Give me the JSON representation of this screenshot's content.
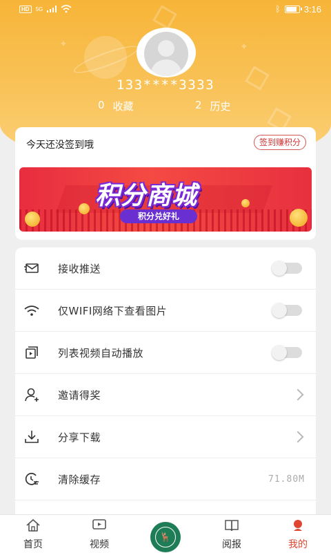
{
  "status_bar": {
    "network_badge": "HD",
    "signal": "5G",
    "time": "3:16",
    "battery_level": 0.9
  },
  "profile": {
    "phone": "133****3333",
    "favorites_count": "0",
    "favorites_label": "收藏",
    "history_count": "2",
    "history_label": "历史"
  },
  "signin": {
    "text": "今天还没签到哦",
    "button": "签到赚积分"
  },
  "banner": {
    "title": "积分商城",
    "subtitle": "积分兑好礼"
  },
  "menu": {
    "items": [
      {
        "label": "接收推送",
        "icon": "envelope-icon",
        "control": "toggle",
        "on": false
      },
      {
        "label": "仅WIFI网络下查看图片",
        "icon": "wifi-icon",
        "control": "toggle",
        "on": false
      },
      {
        "label": "列表视频自动播放",
        "icon": "video-play-icon",
        "control": "toggle",
        "on": false
      },
      {
        "label": "邀请得奖",
        "icon": "user-add-icon",
        "control": "chevron"
      },
      {
        "label": "分享下载",
        "icon": "download-icon",
        "control": "chevron"
      },
      {
        "label": "清除缓存",
        "icon": "clear-cache-icon",
        "control": "value",
        "value": "71.80M"
      }
    ]
  },
  "tabbar": {
    "tabs": [
      {
        "label": "首页",
        "icon": "home-icon"
      },
      {
        "label": "视频",
        "icon": "video-icon"
      },
      {
        "label": "",
        "icon": "center-logo-icon"
      },
      {
        "label": "阅报",
        "icon": "newspaper-icon"
      },
      {
        "label": "我的",
        "icon": "profile-icon",
        "active": true
      }
    ]
  },
  "colors": {
    "header": "#f7b538",
    "accent_red": "#e0452f",
    "center_logo": "#1e7d57"
  }
}
